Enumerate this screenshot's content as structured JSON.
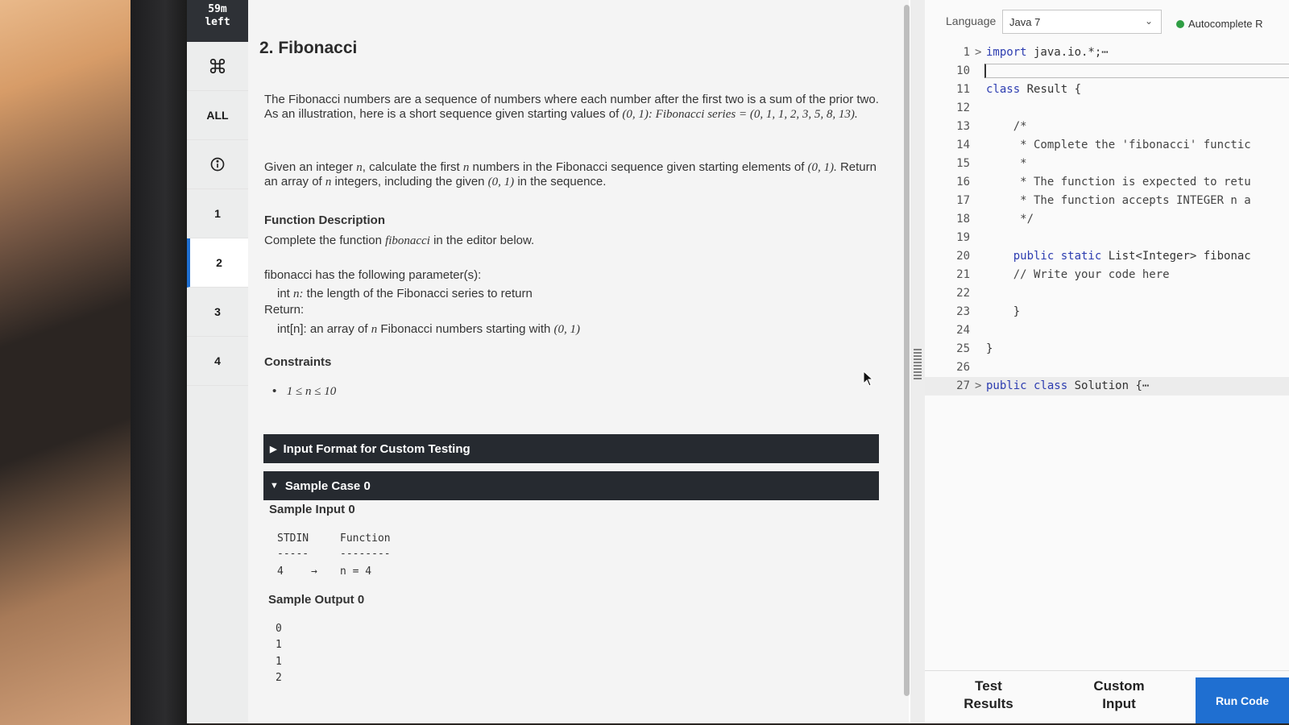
{
  "timer": {
    "line1": "59m",
    "line2": "left"
  },
  "rail": {
    "all_label": "ALL",
    "questions": [
      "1",
      "2",
      "3",
      "4"
    ],
    "active_question": "2"
  },
  "problem": {
    "title": "2. Fibonacci",
    "intro_plain": "The Fibonacci numbers are a sequence of numbers where each number after the first two is a sum of the prior two. As an illustration, here is a short sequence given starting values of ",
    "intro_italic": "(0, 1): Fibonacci series = (0, 1, 1, 2, 3, 5, 8, 13).",
    "given_1": "Given an integer ",
    "given_n": "n",
    "given_2": ", calculate the first ",
    "given_n2": "n",
    "given_3": " numbers in the Fibonacci sequence given starting elements of ",
    "given_start": "(0, 1).",
    "given_4": " Return an array of ",
    "given_n3": "n",
    "given_5": " integers, including the given ",
    "given_start2": "(0, 1)",
    "given_6": " in the sequence.",
    "func_desc_title": "Function Description",
    "func_desc_1": "Complete the function ",
    "func_desc_name": "fibonacci",
    "func_desc_2": " in the editor below.",
    "params_header": "fibonacci has the following parameter(s):",
    "param_1a": "int ",
    "param_1n": "n:",
    "param_1b": "  the length of the Fibonacci series to return",
    "return_label": "Return:",
    "return_1": "int[n]: an array of ",
    "return_n": "n",
    "return_2": " Fibonacci numbers starting with ",
    "return_3": "(0, 1)",
    "constraints_title": "Constraints",
    "constraint_1": "1 ≤ n ≤ 10",
    "input_format_bar": "Input Format for Custom Testing",
    "sample_case_bar": "Sample Case 0",
    "sample_input_title": "Sample Input 0",
    "stdin_header": "STDIN",
    "function_header": "Function",
    "stdin_dash": "-----",
    "function_dash": "--------",
    "stdin_value": "4",
    "arrow": "→",
    "function_value": "n = 4",
    "sample_output_title": "Sample Output 0",
    "output_values": [
      "0",
      "1",
      "1",
      "2"
    ]
  },
  "editor": {
    "language_label": "Language",
    "language_value": "Java 7",
    "autocomplete_label": "Autocomplete R",
    "lines": [
      {
        "num": "1",
        "fold": ">",
        "text": "import java.io.*;⋯",
        "kw": "import"
      },
      {
        "num": "10",
        "fold": "",
        "text": ""
      },
      {
        "num": "11",
        "fold": "",
        "text": "class Result {",
        "kw": "class"
      },
      {
        "num": "12",
        "fold": "",
        "text": ""
      },
      {
        "num": "13",
        "fold": "",
        "text": "    /*"
      },
      {
        "num": "14",
        "fold": "",
        "text": "     * Complete the 'fibonacci' functic"
      },
      {
        "num": "15",
        "fold": "",
        "text": "     *"
      },
      {
        "num": "16",
        "fold": "",
        "text": "     * The function is expected to retu"
      },
      {
        "num": "17",
        "fold": "",
        "text": "     * The function accepts INTEGER n a"
      },
      {
        "num": "18",
        "fold": "",
        "text": "     */"
      },
      {
        "num": "19",
        "fold": "",
        "text": ""
      },
      {
        "num": "20",
        "fold": "",
        "text": "    public static List<Integer> fibonac",
        "kw": "public static"
      },
      {
        "num": "21",
        "fold": "",
        "text": "    // Write your code here"
      },
      {
        "num": "22",
        "fold": "",
        "text": ""
      },
      {
        "num": "23",
        "fold": "",
        "text": "    }"
      },
      {
        "num": "24",
        "fold": "",
        "text": ""
      },
      {
        "num": "25",
        "fold": "",
        "text": "}"
      },
      {
        "num": "26",
        "fold": "",
        "text": ""
      },
      {
        "num": "27",
        "fold": ">",
        "text": "public class Solution {⋯",
        "kw": "public class"
      }
    ],
    "tab_test_results": "Test Results",
    "tab_custom_input": "Custom Input",
    "run_code": "Run Code"
  },
  "colors": {
    "accent": "#1f6fd1",
    "header_bar": "#262a30",
    "timer_bg": "#2e3136",
    "keyword": "#2c3cb0",
    "status_green": "#2f9e44"
  },
  "icons": [
    "command-icon",
    "info-icon",
    "chevron-down-icon",
    "mouse-pointer-icon"
  ]
}
